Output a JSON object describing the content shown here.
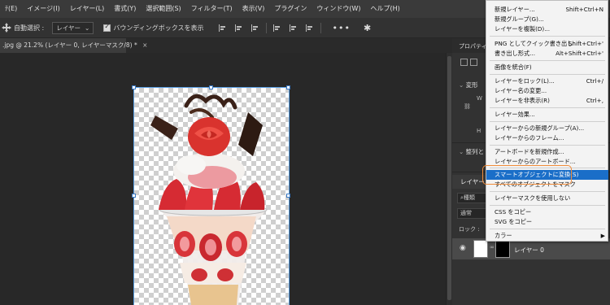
{
  "menubar": {
    "items": [
      "ﾃ(E)",
      "イメージ(I)",
      "レイヤー(L)",
      "書式(Y)",
      "選択範囲(S)",
      "フィルター(T)",
      "表示(V)",
      "プラグイン",
      "ウィンドウ(W)",
      "ヘルプ(H)"
    ]
  },
  "options": {
    "auto_select_label": "自動選択 :",
    "layer_select": "レイヤー",
    "bbox_label": "バウンディングボックスを表示",
    "more": "•••"
  },
  "document": {
    "tab_title": ".jpg @ 21.2% (レイヤー 0, レイヤーマスク/8) *",
    "close": "×"
  },
  "right_panel": {
    "props_title": "プロパティ",
    "transform_label": "変形",
    "align_label": "整列と",
    "layers_tab": "レイヤー",
    "search_label": "種類",
    "blend_mode": "通常",
    "lock_label": "ロック :",
    "layer_name": "レイヤー 0",
    "side_w": "W",
    "side_h": "H"
  },
  "context_menu": {
    "items": [
      {
        "label": "新規レイヤー...",
        "shortcut": "Shift+Ctrl+N"
      },
      {
        "label": "新規グループ(G)...",
        "shortcut": ""
      },
      {
        "label": "レイヤーを複製(D)...",
        "shortcut": ""
      },
      {
        "label": "PNG としてクイック書き出し",
        "shortcut": "Shift+Ctrl+'"
      },
      {
        "label": "書き出し形式...",
        "shortcut": "Alt+Shift+Ctrl+'"
      },
      {
        "label": "画像を統合(F)",
        "shortcut": ""
      },
      {
        "label": "レイヤーをロック(L)...",
        "shortcut": "Ctrl+/"
      },
      {
        "label": "レイヤー名の変更...",
        "shortcut": ""
      },
      {
        "label": "レイヤーを非表示(R)",
        "shortcut": "Ctrl+,"
      },
      {
        "label": "レイヤー効果...",
        "shortcut": ""
      },
      {
        "label": "レイヤーからの新規グループ(A)...",
        "shortcut": ""
      },
      {
        "label": "レイヤーからのフレーム...",
        "shortcut": ""
      },
      {
        "label": "アートボードを新規作成...",
        "shortcut": ""
      },
      {
        "label": "レイヤーからのアートボード...",
        "shortcut": ""
      },
      {
        "label": "スマートオブジェクトに変換(S)",
        "shortcut": ""
      },
      {
        "label": "すべてのオブジェクトをマスク",
        "shortcut": ""
      },
      {
        "label": "レイヤーマスクを使用しない",
        "shortcut": ""
      },
      {
        "label": "CSS をコピー",
        "shortcut": ""
      },
      {
        "label": "SVG をコピー",
        "shortcut": ""
      },
      {
        "label": "カラー",
        "shortcut": ""
      }
    ],
    "highlighted_index": 14
  },
  "colors": {
    "highlight": "#1a6ec8",
    "annotation": "#f08c3a"
  }
}
